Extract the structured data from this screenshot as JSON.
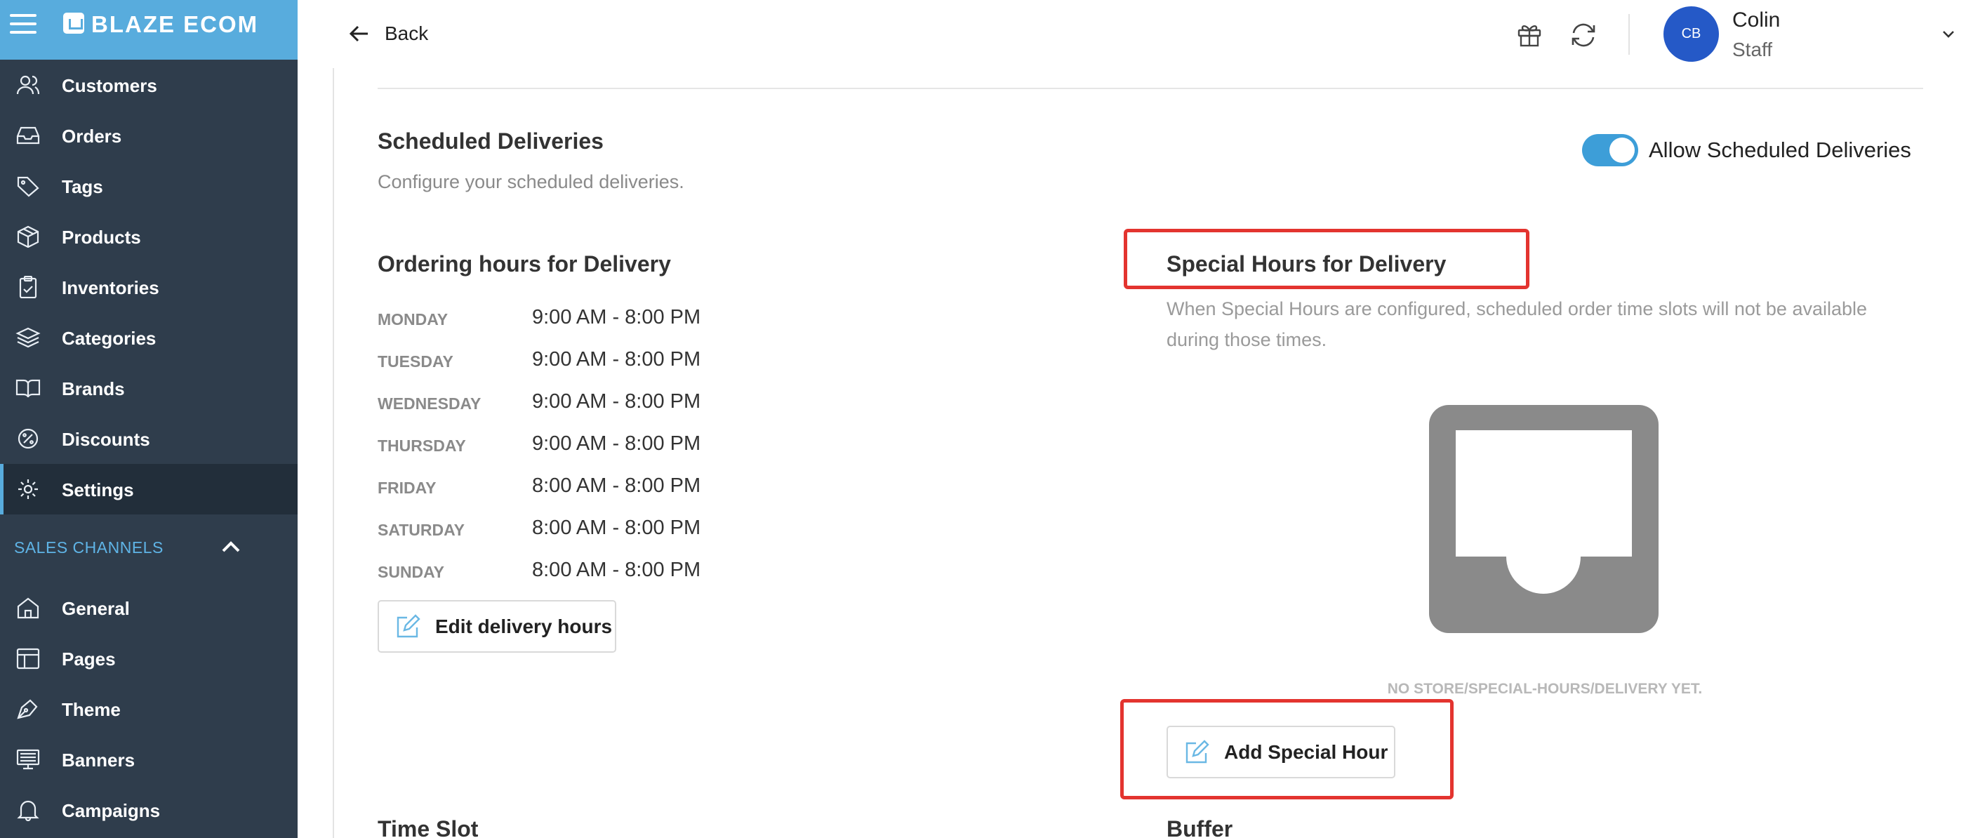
{
  "brand": {
    "name": "BLAZE ECOM",
    "logo_icon": "cart-logo-icon",
    "accent": "#58acdd",
    "sidebar_bg": "#2f3d4c"
  },
  "sidebar": {
    "items": [
      {
        "label": "Customers",
        "icon": "users-icon"
      },
      {
        "label": "Orders",
        "icon": "inbox-icon"
      },
      {
        "label": "Tags",
        "icon": "tag-icon"
      },
      {
        "label": "Products",
        "icon": "box-icon"
      },
      {
        "label": "Inventories",
        "icon": "clipboard-icon"
      },
      {
        "label": "Categories",
        "icon": "layers-icon"
      },
      {
        "label": "Brands",
        "icon": "book-icon"
      },
      {
        "label": "Discounts",
        "icon": "percent-icon"
      },
      {
        "label": "Settings",
        "icon": "gear-icon",
        "active": true
      }
    ],
    "section_title": "SALES CHANNELS",
    "channel_items": [
      {
        "label": "General",
        "icon": "home-icon"
      },
      {
        "label": "Pages",
        "icon": "layout-icon"
      },
      {
        "label": "Theme",
        "icon": "pen-icon"
      },
      {
        "label": "Banners",
        "icon": "monitor-icon"
      },
      {
        "label": "Campaigns",
        "icon": "bell-icon"
      }
    ]
  },
  "header": {
    "back_label": "Back",
    "user": {
      "initials": "CB",
      "name": "Colin",
      "role": "Staff"
    }
  },
  "scheduled": {
    "title": "Scheduled Deliveries",
    "subtitle": "Configure your scheduled deliveries.",
    "toggle_label": "Allow Scheduled Deliveries",
    "toggle_on": true
  },
  "ordering_hours": {
    "title": "Ordering hours for Delivery",
    "days": [
      {
        "day": "MONDAY",
        "hours": "9:00 AM - 8:00 PM"
      },
      {
        "day": "TUESDAY",
        "hours": "9:00 AM - 8:00 PM"
      },
      {
        "day": "WEDNESDAY",
        "hours": "9:00 AM - 8:00 PM"
      },
      {
        "day": "THURSDAY",
        "hours": "9:00 AM - 8:00 PM"
      },
      {
        "day": "FRIDAY",
        "hours": "8:00 AM - 8:00 PM"
      },
      {
        "day": "SATURDAY",
        "hours": "8:00 AM - 8:00 PM"
      },
      {
        "day": "SUNDAY",
        "hours": "8:00 AM - 8:00 PM"
      }
    ],
    "edit_button": "Edit delivery hours"
  },
  "special_hours": {
    "title": "Special Hours for Delivery",
    "description": "When Special Hours are configured, scheduled order time slots will not be available during those times.",
    "empty_text": "NO STORE/SPECIAL-HOURS/DELIVERY YET.",
    "add_button": "Add Special Hour"
  },
  "sections": {
    "time_slot": "Time Slot",
    "buffer": "Buffer"
  },
  "colors": {
    "highlight": "#e3342f",
    "avatar": "#2559c7",
    "toggle": "#3d9ed8"
  }
}
